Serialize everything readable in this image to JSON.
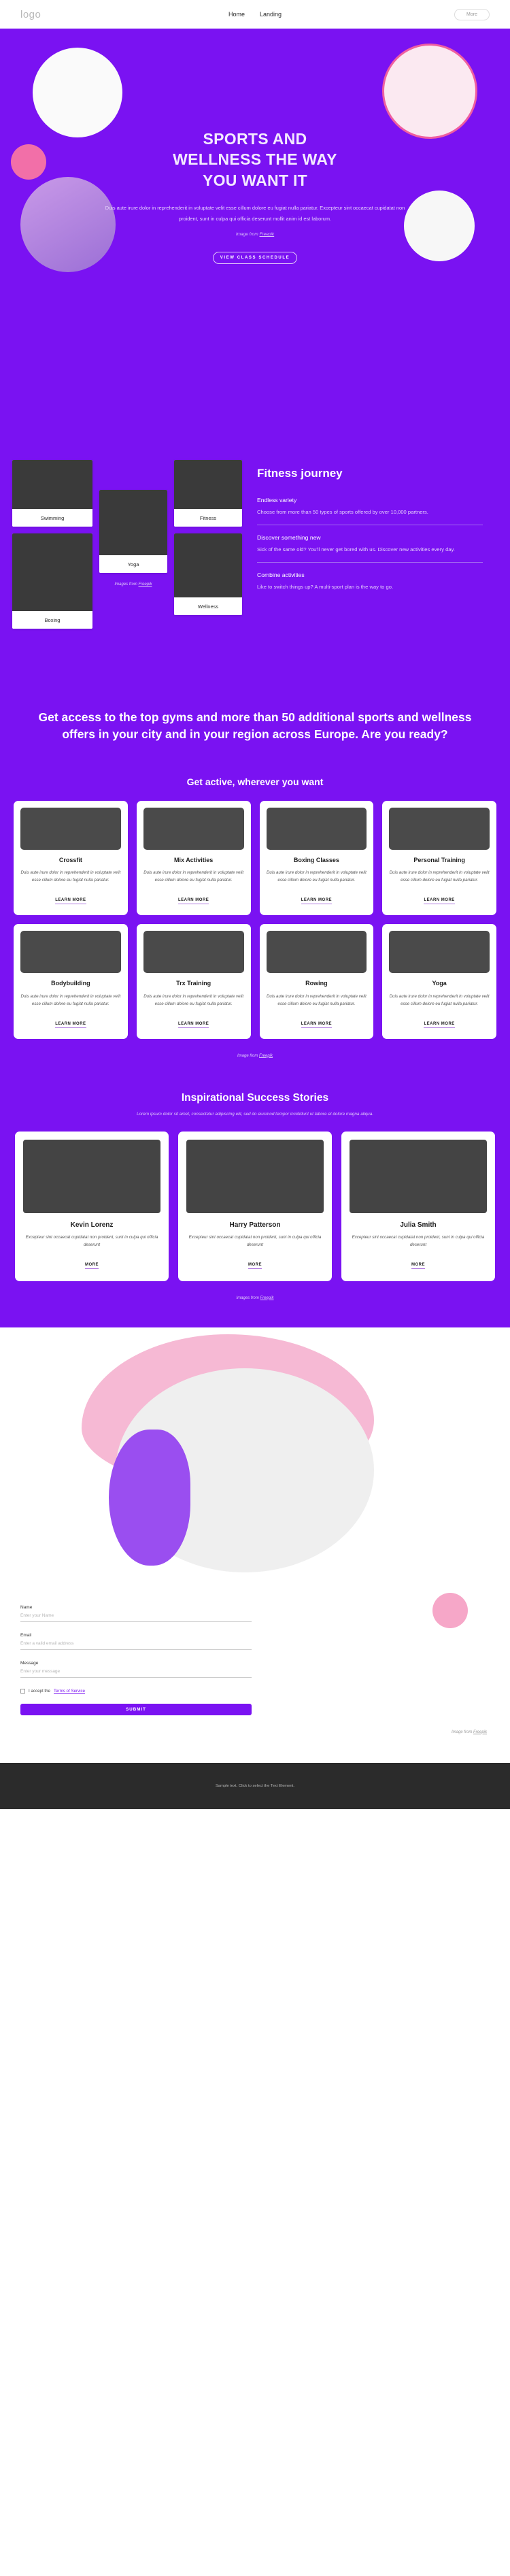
{
  "header": {
    "logo": "logo",
    "nav": [
      {
        "label": "Home"
      },
      {
        "label": "Landing"
      }
    ],
    "more_label": "More"
  },
  "hero": {
    "title_line1": "SPORTS AND",
    "title_line2": "WELLNESS THE WAY",
    "title_line3": "YOU WANT IT",
    "description": "Duis aute irure dolor in reprehenderit in voluptate velit esse cillum dolore eu fugiat nulla pariatur. Excepteur sint occaecat cupidatat non proident, sunt in culpa qui officia deserunt mollit anim id est laborum.",
    "credit_prefix": "Image from ",
    "credit_link": "Freepik",
    "cta_label": "VIEW CLASS SCHEDULE",
    "bg_color": "#7a12f2",
    "pink_color": "#f26fa8"
  },
  "journey": {
    "title": "Fitness journey",
    "gallery": [
      {
        "caption": "Swimming"
      },
      {
        "caption": "Boxing"
      },
      {
        "caption": "Yoga"
      },
      {
        "caption": "Fitness"
      },
      {
        "caption": "Wellness"
      }
    ],
    "gallery_credit_prefix": "Images from ",
    "gallery_credit_link": "Freepik",
    "items": [
      {
        "question": "Endless variety",
        "answer": "Choose from more than 50 types of sports offered by over 10,000 partners."
      },
      {
        "question": "Discover something new",
        "answer": "Sick of the same old? You'll never get bored with us. Discover new activities every day."
      },
      {
        "question": "Combine activities",
        "answer": "Like to switch things up? A multi-sport plan is the way to go."
      }
    ]
  },
  "banner": {
    "heading": "Get access to the top gyms and more than 50 additional sports and wellness offers in your city and in your region across Europe. Are you ready?"
  },
  "activities": {
    "heading": "Get active, wherever you want",
    "body": "Duis aute irure dolor in reprehenderit in voluptate velit esse cillum dolore eu fugiat nulla pariatur.",
    "learn_more": "LEARN MORE",
    "cards": [
      {
        "title": "Crossfit"
      },
      {
        "title": "Mix Activities"
      },
      {
        "title": "Boxing Classes"
      },
      {
        "title": "Personal Training"
      },
      {
        "title": "Bodybuilding"
      },
      {
        "title": "Trx Training"
      },
      {
        "title": "Rowing"
      },
      {
        "title": "Yoga"
      }
    ],
    "credit_prefix": "Image from ",
    "credit_link": "Freepik"
  },
  "stories": {
    "heading": "Inspirational Success Stories",
    "subtitle": "Lorem ipsum dolor sit amet, consectetur adipiscing elit, sed do eiusmod tempor incididunt ut labore et dolore magna aliqua.",
    "more_label": "MORE",
    "body": "Excepteur sint occaecat cupidatat non proident, sunt in culpa qui officia deserunt",
    "cards": [
      {
        "name": "Kevin Lorenz"
      },
      {
        "name": "Harry Patterson"
      },
      {
        "name": "Julia Smith"
      }
    ],
    "credit_prefix": "Images from ",
    "credit_link": "Freepik"
  },
  "contact": {
    "fields": [
      {
        "label": "Name",
        "placeholder": "Enter your Name"
      },
      {
        "label": "Email",
        "placeholder": "Enter a valid email address"
      },
      {
        "label": "Message",
        "placeholder": "Enter your message"
      }
    ],
    "consent_prefix": "I accept the ",
    "consent_link": "Terms of Service",
    "submit_label": "SUBMIT",
    "credit_prefix": "Image from ",
    "credit_link": "Freepik"
  },
  "footer": {
    "text": "Sample text. Click to select the Text Element."
  }
}
